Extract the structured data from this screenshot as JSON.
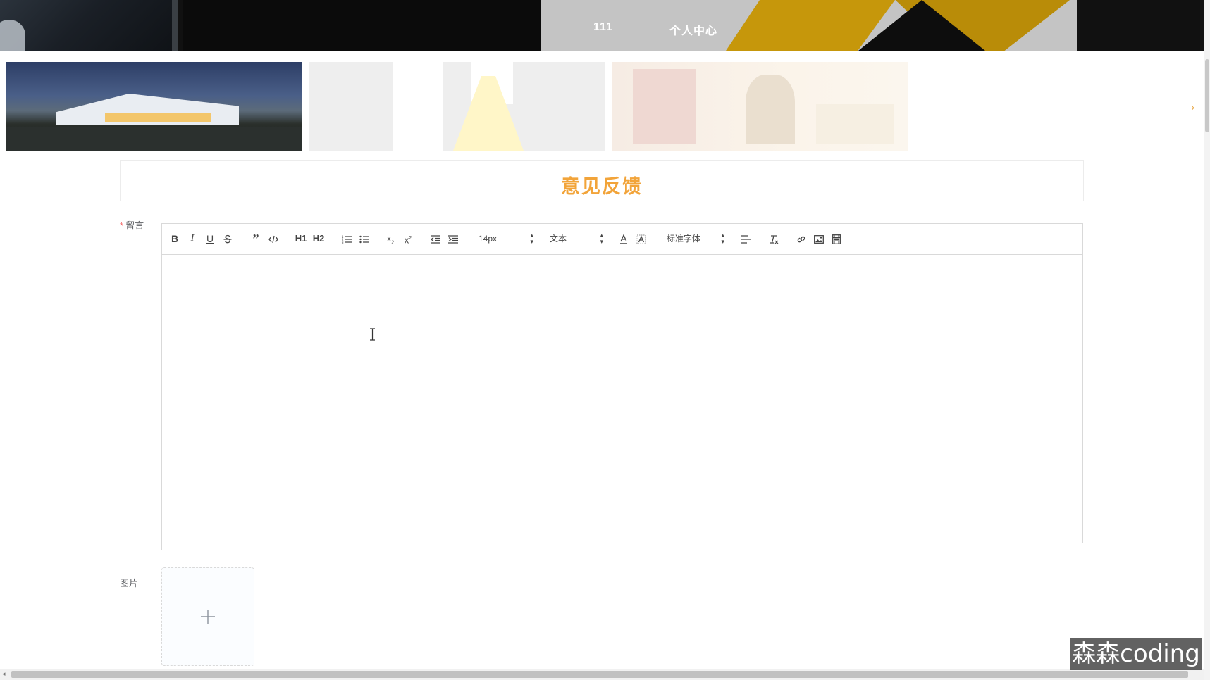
{
  "header": {
    "nav_items": [
      "111",
      "个人中心"
    ]
  },
  "carousel": {
    "slides": [
      "slide-1",
      "slide-2",
      "slide-3"
    ]
  },
  "feedback": {
    "title": "意见反馈",
    "message_label": "留言",
    "required_mark": "*",
    "image_label": "图片"
  },
  "toolbar": {
    "font_size": "14px",
    "header_type": "文本",
    "font_family": "标准字体",
    "bold": "B",
    "italic": "I",
    "underline": "U",
    "h1": "H1",
    "h2": "H2"
  },
  "watermark": "森森coding",
  "colors": {
    "accent": "#f2a43a",
    "required": "#f56c6c",
    "border": "#d9d9d9"
  }
}
